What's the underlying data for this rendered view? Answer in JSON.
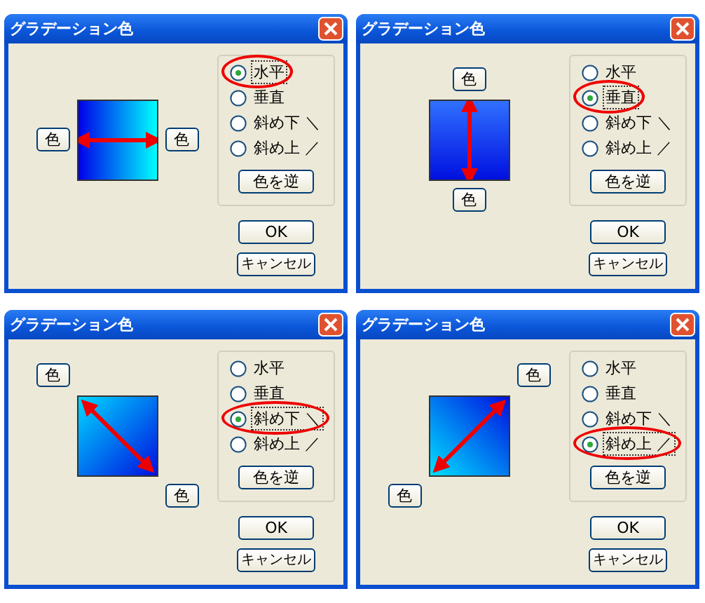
{
  "dialogs": [
    {
      "title": "グラデーション色",
      "kind": "horizontal",
      "color_buttons": [
        "色",
        "色"
      ],
      "options": [
        {
          "label": "水平",
          "selected": true,
          "circled": true
        },
        {
          "label": "垂直",
          "selected": false,
          "circled": false
        },
        {
          "label": "斜め下 ＼",
          "selected": false,
          "circled": false
        },
        {
          "label": "斜め上 ／",
          "selected": false,
          "circled": false
        }
      ],
      "reverse_button": "色を逆",
      "ok_button": "OK",
      "cancel_button": "キャンセル"
    },
    {
      "title": "グラデーション色",
      "kind": "vertical",
      "color_buttons": [
        "色",
        "色"
      ],
      "options": [
        {
          "label": "水平",
          "selected": false,
          "circled": false
        },
        {
          "label": "垂直",
          "selected": true,
          "circled": true
        },
        {
          "label": "斜め下 ＼",
          "selected": false,
          "circled": false
        },
        {
          "label": "斜め上 ／",
          "selected": false,
          "circled": false
        }
      ],
      "reverse_button": "色を逆",
      "ok_button": "OK",
      "cancel_button": "キャンセル"
    },
    {
      "title": "グラデーション色",
      "kind": "diagonal-down",
      "color_buttons": [
        "色",
        "色"
      ],
      "options": [
        {
          "label": "水平",
          "selected": false,
          "circled": false
        },
        {
          "label": "垂直",
          "selected": false,
          "circled": false
        },
        {
          "label": "斜め下 ＼",
          "selected": true,
          "circled": true
        },
        {
          "label": "斜め上 ／",
          "selected": false,
          "circled": false
        }
      ],
      "reverse_button": "色を逆",
      "ok_button": "OK",
      "cancel_button": "キャンセル"
    },
    {
      "title": "グラデーション色",
      "kind": "diagonal-up",
      "color_buttons": [
        "色",
        "色"
      ],
      "options": [
        {
          "label": "水平",
          "selected": false,
          "circled": false
        },
        {
          "label": "垂直",
          "selected": false,
          "circled": false
        },
        {
          "label": "斜め下 ＼",
          "selected": false,
          "circled": false
        },
        {
          "label": "斜め上 ／",
          "selected": true,
          "circled": true
        }
      ],
      "reverse_button": "色を逆",
      "ok_button": "OK",
      "cancel_button": "キャンセル"
    }
  ]
}
